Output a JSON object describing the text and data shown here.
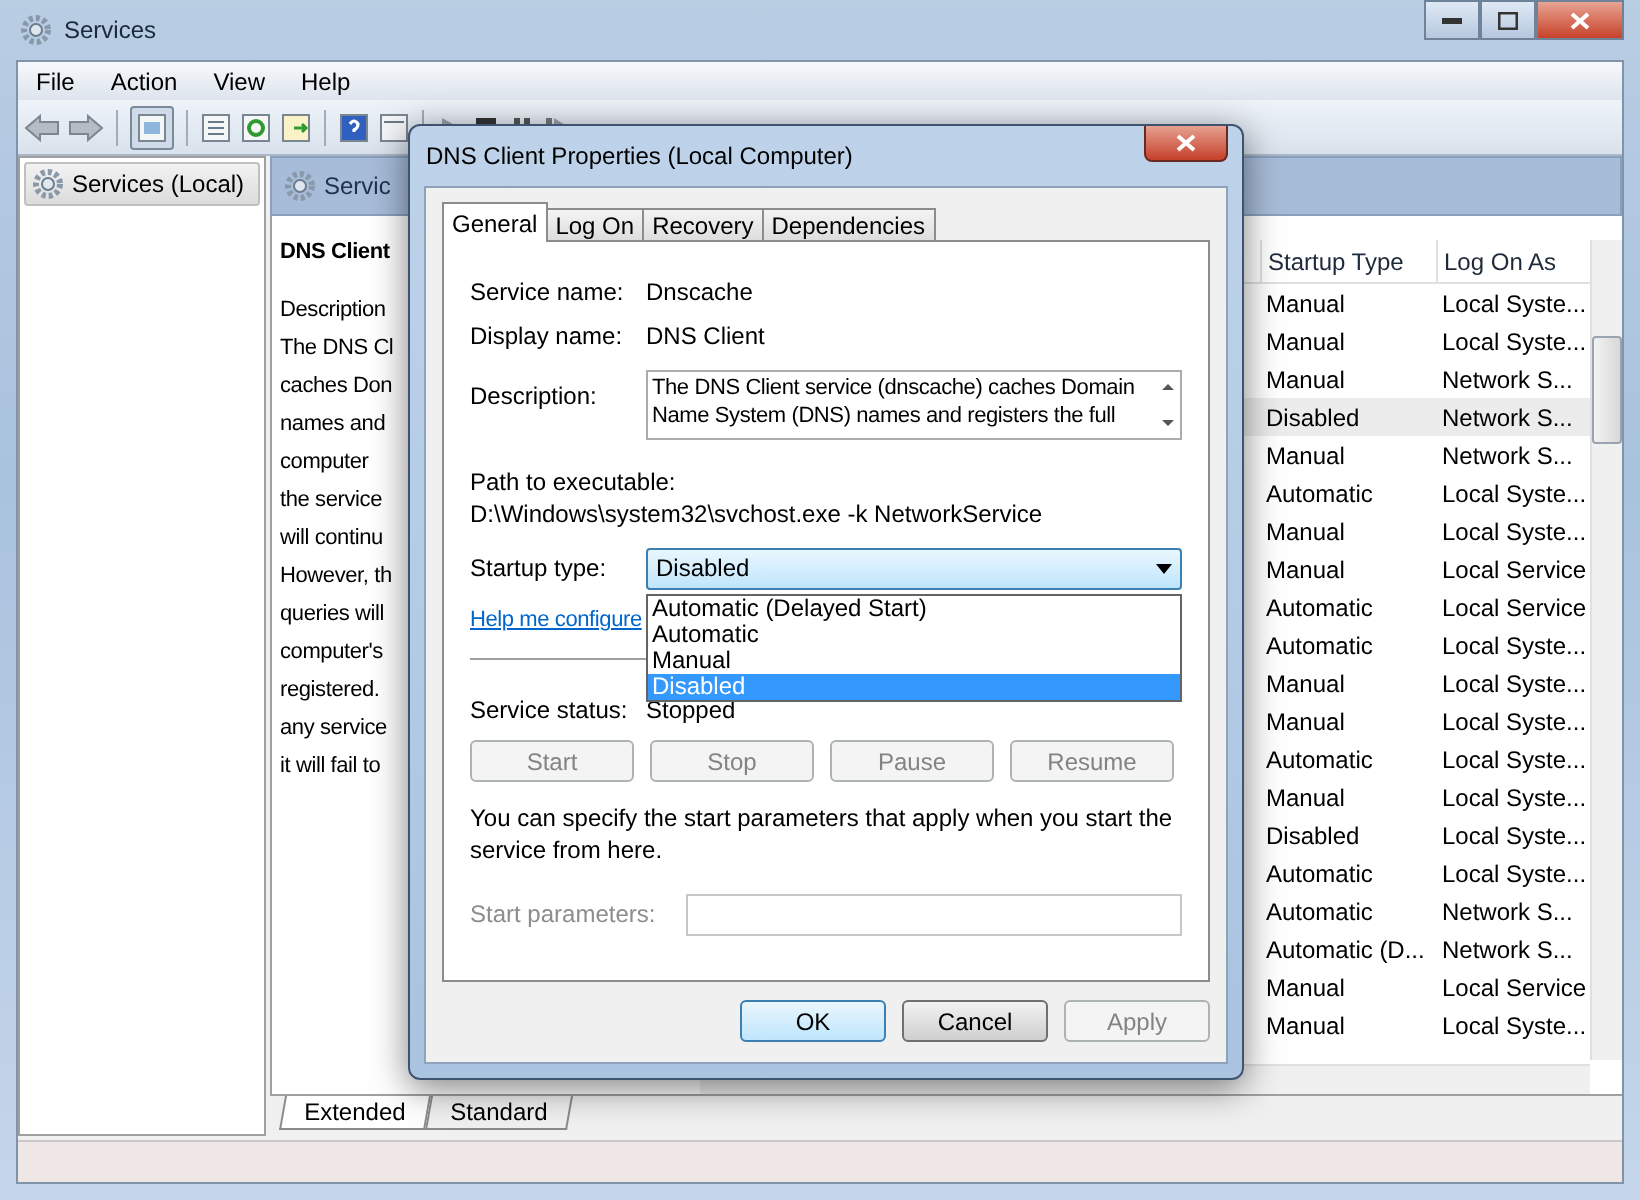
{
  "window": {
    "title": "Services",
    "menu": [
      "File",
      "Action",
      "View",
      "Help"
    ]
  },
  "tree": [
    {
      "label": "Services (Local)",
      "selected": true
    }
  ],
  "pane_header": "Servic",
  "description_pane": {
    "title": "DNS Client",
    "lines": [
      "Description",
      "The DNS Cl",
      "caches Don",
      "names and",
      "computer",
      "the service",
      "will continu",
      "However, th",
      "queries will",
      "computer's",
      "registered.",
      "any service",
      "it will fail to"
    ]
  },
  "list": {
    "columns": [
      "Startup Type",
      "Log On As"
    ],
    "rows": [
      {
        "startup_type": "Manual",
        "log_on_as": "Local Syste...",
        "selected": false
      },
      {
        "startup_type": "Manual",
        "log_on_as": "Local Syste...",
        "selected": false
      },
      {
        "startup_type": "Manual",
        "log_on_as": "Network S...",
        "selected": false
      },
      {
        "startup_type": "Disabled",
        "log_on_as": "Network S...",
        "selected": true
      },
      {
        "startup_type": "Manual",
        "log_on_as": "Network S...",
        "selected": false
      },
      {
        "startup_type": "Automatic",
        "log_on_as": "Local Syste...",
        "selected": false
      },
      {
        "startup_type": "Manual",
        "log_on_as": "Local Syste...",
        "selected": false
      },
      {
        "startup_type": "Manual",
        "log_on_as": "Local Service",
        "selected": false
      },
      {
        "startup_type": "Automatic",
        "log_on_as": "Local Service",
        "selected": false
      },
      {
        "startup_type": "Automatic",
        "log_on_as": "Local Syste...",
        "selected": false
      },
      {
        "startup_type": "Manual",
        "log_on_as": "Local Syste...",
        "selected": false
      },
      {
        "startup_type": "Manual",
        "log_on_as": "Local Syste...",
        "selected": false
      },
      {
        "startup_type": "Automatic",
        "log_on_as": "Local Syste...",
        "selected": false
      },
      {
        "startup_type": "Manual",
        "log_on_as": "Local Syste...",
        "selected": false
      },
      {
        "startup_type": "Disabled",
        "log_on_as": "Local Syste...",
        "selected": false
      },
      {
        "startup_type": "Automatic",
        "log_on_as": "Local Syste...",
        "selected": false
      },
      {
        "startup_type": "Automatic",
        "log_on_as": "Network S...",
        "selected": false
      },
      {
        "startup_type": "Automatic (D...",
        "log_on_as": "Network S...",
        "selected": false
      },
      {
        "startup_type": "Manual",
        "log_on_as": "Local Service",
        "selected": false
      },
      {
        "startup_type": "Manual",
        "log_on_as": "Local Syste...",
        "selected": false
      }
    ]
  },
  "view_tabs": [
    {
      "label": "Extended",
      "selected": true
    },
    {
      "label": "Standard",
      "selected": false
    }
  ],
  "dialog": {
    "title": "DNS Client Properties (Local Computer)",
    "tabs": [
      {
        "label": "General",
        "selected": true
      },
      {
        "label": "Log On",
        "selected": false
      },
      {
        "label": "Recovery",
        "selected": false
      },
      {
        "label": "Dependencies",
        "selected": false
      }
    ],
    "service_name": {
      "label": "Service name:",
      "value": "Dnscache"
    },
    "display_name": {
      "label": "Display name:",
      "value": "DNS Client"
    },
    "description": {
      "label": "Description:",
      "value": "The DNS Client service (dnscache) caches Domain Name System (DNS) names and registers the full"
    },
    "path": {
      "label": "Path to executable:",
      "value": "D:\\Windows\\system32\\svchost.exe -k NetworkService"
    },
    "startup_type": {
      "label": "Startup type:",
      "value": "Disabled",
      "expanded": true,
      "options": [
        {
          "label": "Automatic (Delayed Start)",
          "selected": false
        },
        {
          "label": "Automatic",
          "selected": false
        },
        {
          "label": "Manual",
          "selected": false
        },
        {
          "label": "Disabled",
          "selected": true
        }
      ]
    },
    "help_link": "Help me configure",
    "service_status": {
      "label": "Service status:",
      "value": "Stopped"
    },
    "service_buttons": [
      {
        "label": "Start",
        "disabled": true
      },
      {
        "label": "Stop",
        "disabled": true
      },
      {
        "label": "Pause",
        "disabled": true
      },
      {
        "label": "Resume",
        "disabled": true
      }
    ],
    "note": "You can specify the start parameters that apply when you start the service from here.",
    "start_parameters": {
      "label": "Start parameters:",
      "disabled": true
    },
    "buttons": [
      {
        "label": "OK",
        "disabled": false
      },
      {
        "label": "Cancel",
        "disabled": false
      },
      {
        "label": "Apply",
        "disabled": true
      }
    ]
  }
}
